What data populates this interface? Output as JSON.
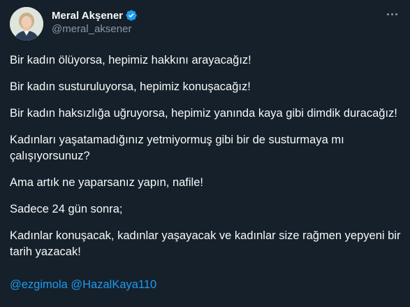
{
  "author": {
    "display_name": "Meral Akşener",
    "handle": "@meral_aksener",
    "verified": true,
    "avatar_icon": "profile-photo"
  },
  "colors": {
    "background": "#15202b",
    "text": "#f7f9f9",
    "secondary": "#8b98a5",
    "accent": "#1d9bf0"
  },
  "tweet": {
    "paragraphs": [
      "Bir kadın ölüyorsa, hepimiz hakkını arayacağız!",
      "Bir kadın susturuluyorsa, hepimiz konuşacağız!",
      "Bir kadın haksızlığa uğruyorsa, hepimiz yanında kaya gibi dimdik duracağız!",
      "Kadınları yaşatamadığınız yetmiyormuş gibi bir de susturmaya mı çalışıyorsunuz?",
      "Ama artık ne yaparsanız yapın, nafile!",
      "Sadece 24 gün sonra;",
      "Kadınlar konuşacak, kadınlar yaşayacak ve kadınlar size rağmen yepyeni bir tarih yazacak!"
    ],
    "mentions": [
      "@ezgimola",
      "@HazalKaya110"
    ]
  }
}
